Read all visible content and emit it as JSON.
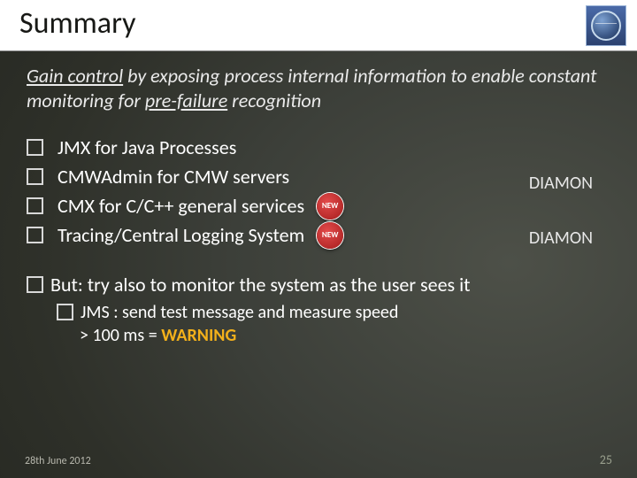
{
  "title": "Summary",
  "subtitle_parts": {
    "u1": "Gain control",
    "mid": " by exposing process internal information to enable constant monitoring for ",
    "u2": "pre-failure",
    "tail": " recognition"
  },
  "bullets": [
    "JMX for Java Processes",
    "CMWAdmin for CMW servers",
    "CMX for C/C++ general services",
    "Tracing/Central Logging System"
  ],
  "badge_text": "NEW",
  "side": [
    "DIAMON",
    "DIAMON"
  ],
  "but": "But: try also to monitor the system as the user sees it",
  "sub_bullet": "JMS : send test message and measure speed",
  "sub_line2_pre": "> 100 ms = ",
  "warning": "WARNING",
  "footer_date": "28th June 2012",
  "slide_no": "25"
}
